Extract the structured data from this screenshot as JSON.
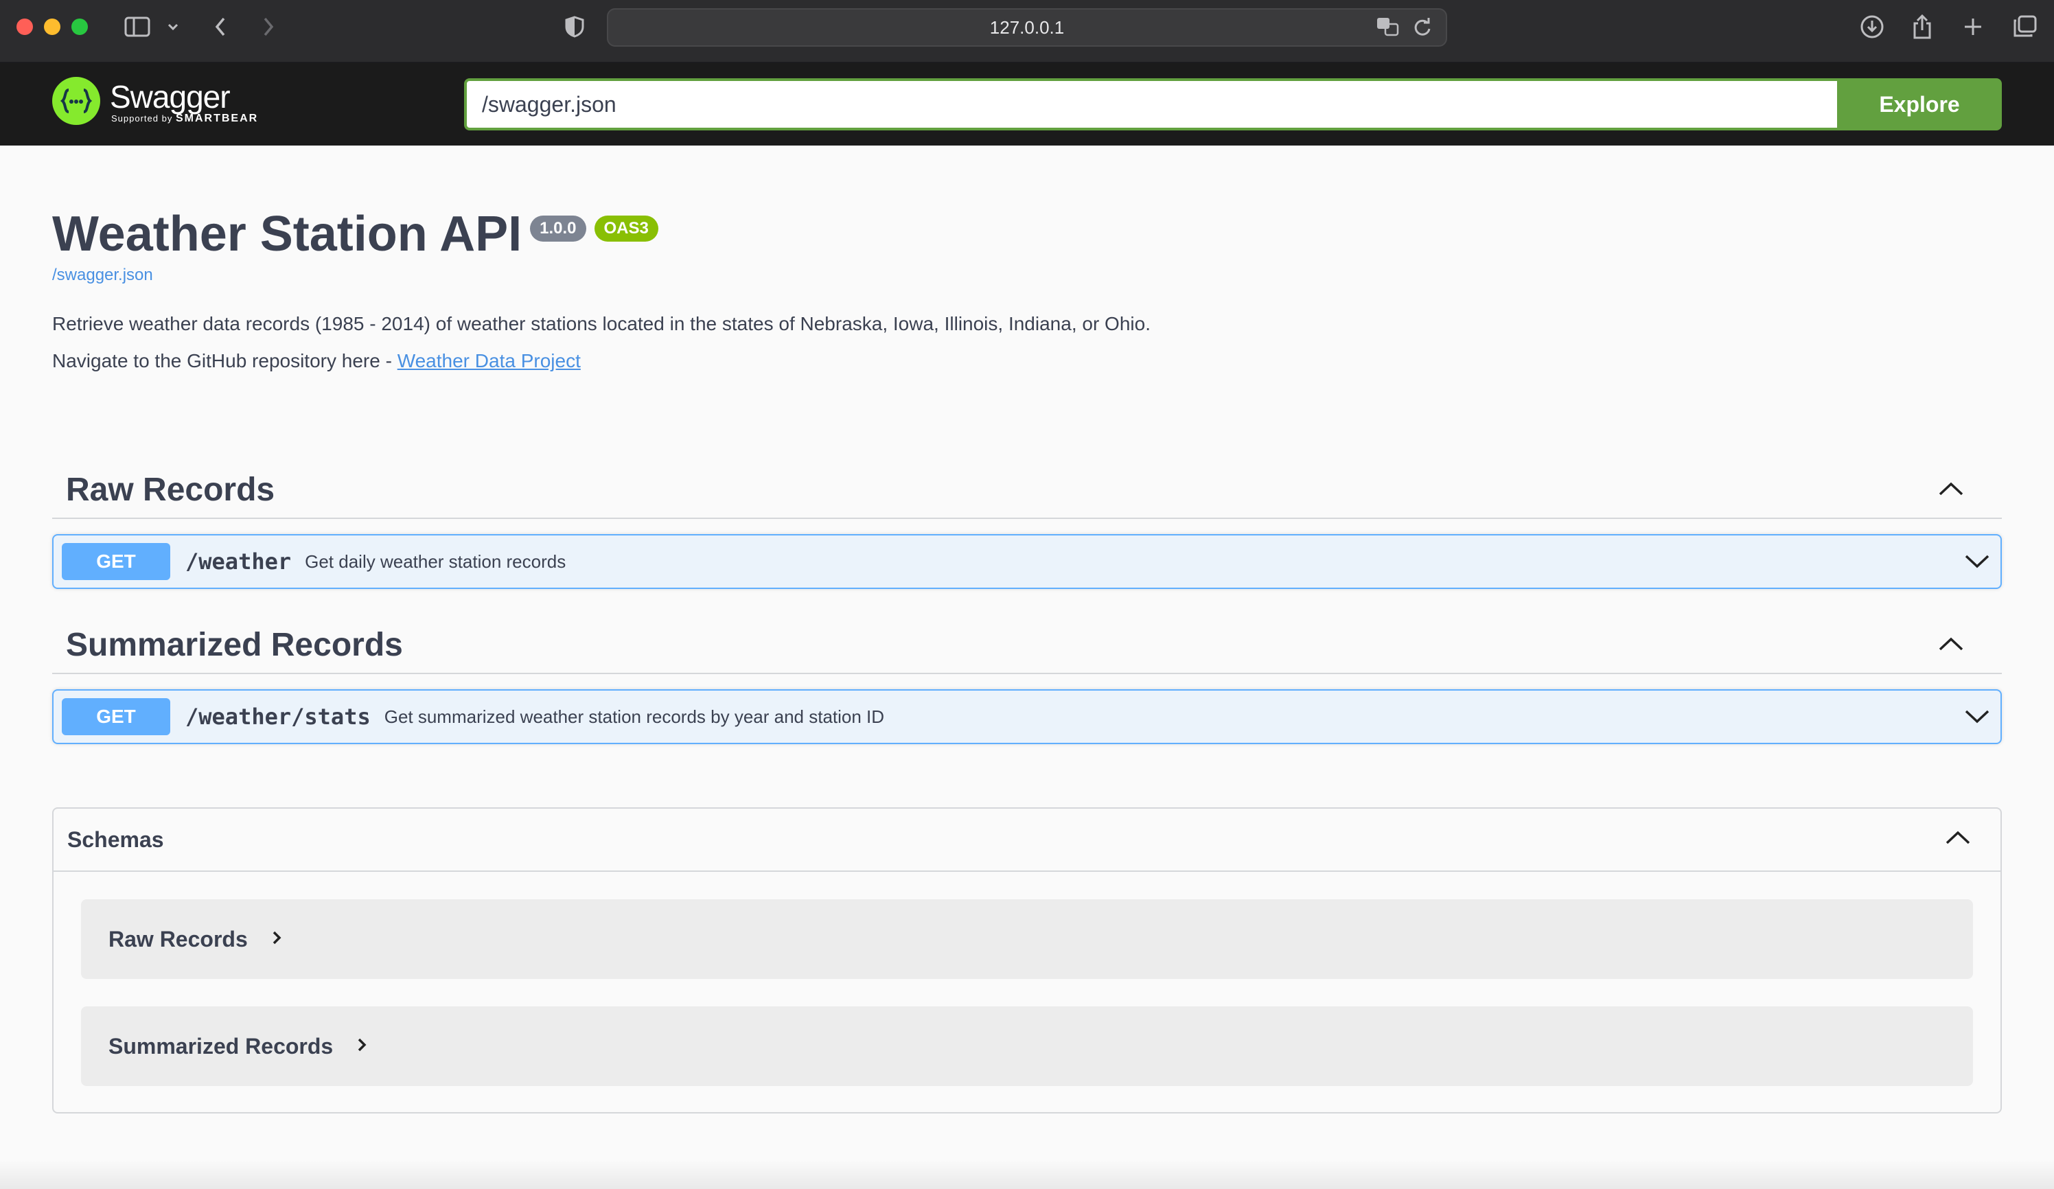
{
  "browser": {
    "url": "127.0.0.1",
    "icons": [
      "sidebar-icon",
      "chevron-down-icon",
      "back-icon",
      "forward-icon",
      "shield-icon",
      "translate-icon",
      "reload-icon",
      "download-icon",
      "share-icon",
      "new-tab-icon",
      "tabs-overview-icon"
    ]
  },
  "topbar": {
    "logo_word": "Swagger",
    "logo_sub_prefix": "Supported by",
    "logo_sub_brand": "SMARTBEAR",
    "logo_glyph": "{···}",
    "explore_value": "/swagger.json",
    "explore_button": "Explore",
    "accent_color": "#62a03f",
    "bar_color": "#1b1b1b"
  },
  "info": {
    "title": "Weather Station API",
    "version": "1.0.0",
    "oas_badge": "OAS3",
    "spec_link": "/swagger.json",
    "description": "Retrieve weather data records (1985 - 2014) of weather stations located in the states of Nebraska, Iowa, Illinois, Indiana, or Ohio.",
    "repo_prefix": "Navigate to the GitHub repository here - ",
    "repo_link": "Weather Data Project"
  },
  "tags": [
    {
      "name": "Raw Records",
      "operations": [
        {
          "method": "GET",
          "path": "/weather",
          "summary": "Get daily weather station records"
        }
      ]
    },
    {
      "name": "Summarized Records",
      "operations": [
        {
          "method": "GET",
          "path": "/weather/stats",
          "summary": "Get summarized weather station records by year and station ID"
        }
      ]
    }
  ],
  "schemas": {
    "title": "Schemas",
    "models": [
      "Raw Records",
      "Summarized Records"
    ]
  },
  "colors": {
    "get_method": "#61affe",
    "get_background": "#ebf3fb",
    "version_badge": "#7d8492",
    "oas_badge": "#89bf04",
    "link": "#4990e2"
  }
}
